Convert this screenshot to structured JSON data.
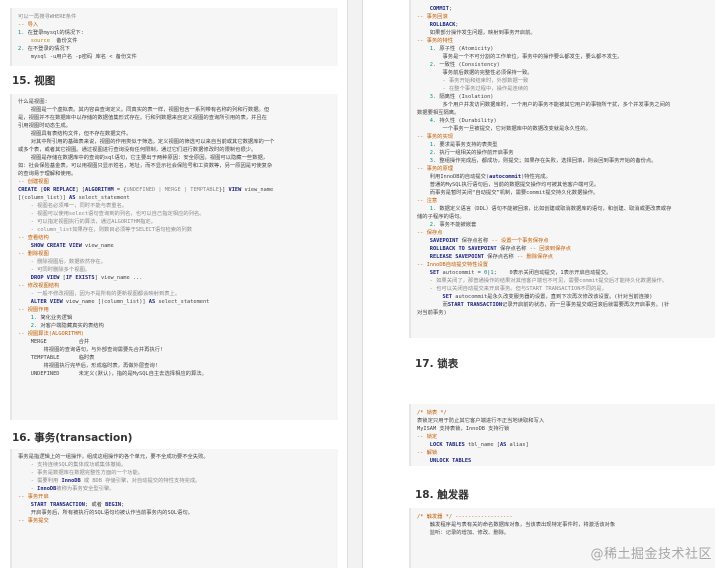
{
  "left": {
    "block1": [
      [
        [
          "c-gr",
          "可以一再搜寻WHERE条件"
        ]
      ],
      [
        [
          "c-cm",
          "-- 导入"
        ]
      ],
      [
        [
          "c-nm",
          "1."
        ],
        [
          "",
          " 在登录mysql的情况下:"
        ]
      ],
      [
        [
          "",
          "    "
        ],
        [
          "c-st",
          "source"
        ],
        [
          "",
          "  备份文件"
        ]
      ],
      [
        [
          "c-nm",
          "2."
        ],
        [
          "",
          " 在不登录的情况下"
        ]
      ],
      [
        [
          "",
          "    mysql -u用户名 -p密码 库名 < 备份文件"
        ]
      ]
    ],
    "h_views": "15. 视图",
    "block2": [
      [
        [
          "",
          "什么是视图:"
        ]
      ],
      [
        [
          "",
          "    视图是一个虚拟表。其内容由查询定义。同真实的表一样，视图包含一系列带有名称的列和行数据。但"
        ]
      ],
      [
        [
          "",
          "是，视图并不在数据库中以存储的数据值集形式存在。行和列数据来自定义视图的查询所引用的表，并且在"
        ]
      ],
      [
        [
          "",
          "引用视图时动态生成。"
        ]
      ],
      [
        [
          "",
          "    视图具有表结构文件，但不存在数据文件。"
        ]
      ],
      [
        [
          "",
          "    对其中所引用的基础表来说，视图的作用类似于筛选。定义视图的筛选可以来自当前或其它数据库的一个"
        ]
      ],
      [
        [
          "",
          "或多个表，或者其它视图。通过视图进行查询没有任何限制，通过它们进行数据修改时的限制也很少。"
        ]
      ],
      [
        [
          "",
          "    视图是存储在数据库中的查询的sql语句，它主要出于两种原因：安全原因，视图可以隐藏一些数据，"
        ]
      ],
      [
        [
          "",
          "如：社会保险基金表，可以用视图只显示姓名，地址，而不显示社会保险号和工资数等，另一原因是可使复杂"
        ]
      ],
      [
        [
          "",
          "的查询易于理解和使用。"
        ]
      ],
      [
        [
          "c-cm",
          "-- 创建视图"
        ]
      ],
      [
        [
          "c-kw",
          "CREATE"
        ],
        [
          "",
          " ["
        ],
        [
          "c-kw",
          "OR REPLACE"
        ],
        [
          "",
          "] ["
        ],
        [
          "c-kw",
          "ALGORITHM"
        ],
        [
          "",
          " = {"
        ],
        [
          "c-gr",
          "UNDEFINED | MERGE | TEMPTABLE"
        ],
        [
          "",
          "}] "
        ],
        [
          "c-kw",
          "VIEW"
        ],
        [
          "",
          " view_name"
        ]
      ],
      [
        [
          "",
          "[(column_list)] "
        ],
        [
          "c-kw",
          "AS"
        ],
        [
          "",
          " select_statement"
        ]
      ],
      [
        [
          "c-gr",
          "    - 视图名必须唯一，同时不能与表重名。"
        ]
      ],
      [
        [
          "c-gr",
          "    - 视图可以使用select语句查询到的列名，也可以自己指定相应的列名。"
        ]
      ],
      [
        [
          "c-gr",
          "    - 可以指定视图执行的算法，通过ALGORITHM指定。"
        ]
      ],
      [
        [
          "c-gr",
          "    - column_list如果存在，则数目必须等于SELECT语句检索的列数"
        ]
      ],
      [
        [
          "c-cm",
          "-- 查看结构"
        ]
      ],
      [
        [
          "",
          "    "
        ],
        [
          "c-kw",
          "SHOW CREATE VIEW"
        ],
        [
          "",
          " view_name"
        ]
      ],
      [
        [
          "c-cm",
          "-- 删除视图"
        ]
      ],
      [
        [
          "c-gr",
          "    - 删除视图后，数据依然存在。"
        ]
      ],
      [
        [
          "c-gr",
          "    - 可同时删除多个视图。"
        ]
      ],
      [
        [
          "",
          "    "
        ],
        [
          "c-kw",
          "DROP VIEW"
        ],
        [
          "",
          " ["
        ],
        [
          "c-kw",
          "IF EXISTS"
        ],
        [
          "",
          "] view_name ..."
        ]
      ],
      [
        [
          "c-cm",
          "-- 修改视图结构"
        ]
      ],
      [
        [
          "c-gr",
          "    - 一般不修改视图，因为不是所有的更新视图都会映射到表上。"
        ]
      ],
      [
        [
          "",
          "    "
        ],
        [
          "c-kw",
          "ALTER VIEW"
        ],
        [
          "",
          " view_name [(column_list)] "
        ],
        [
          "c-kw",
          "AS"
        ],
        [
          "",
          " select_statement"
        ]
      ],
      [
        [
          "c-cm",
          "-- 视图作用"
        ]
      ],
      [
        [
          "c-nm",
          "    1."
        ],
        [
          "",
          " 简化业务逻辑"
        ]
      ],
      [
        [
          "c-nm",
          "    2."
        ],
        [
          "",
          " 对客户端隐藏真实的表结构"
        ]
      ],
      [
        [
          "c-cm",
          "-- 视图算法(ALGORITHM)"
        ]
      ],
      [
        [
          "",
          "    MERGE          合并"
        ]
      ],
      [
        [
          "",
          "        将视图的查询语句，与外部查询需要先合并再执行!"
        ]
      ],
      [
        [
          "",
          "    TEMPTABLE      临时表"
        ]
      ],
      [
        [
          "",
          "        将视图执行完毕后，形成临时表，再做外层查询!"
        ]
      ],
      [
        [
          "",
          "    UNDEFINED      未定义(默认)，指的是MySQL自主去选择相应的算法。"
        ]
      ]
    ],
    "h_transaction": "16. 事务(transaction)",
    "block3": [
      [
        [
          "",
          "事务是指逻辑上的一组操作，组成这组操作的各个单元，要不全成功要不全失败。"
        ]
      ],
      [
        [
          "c-gr",
          "    - 支持连续SQL的集体成功或集体撤销。"
        ]
      ],
      [
        [
          "c-gr",
          "    - 事务是数据库在数据完整性方面的一个功能。"
        ]
      ],
      [
        [
          "c-gr",
          "    - 需要利用 "
        ],
        [
          "c-kw",
          "InnoDB"
        ],
        [
          "c-gr",
          " 或 BDB 存储引擎，对自动提交的特性支持完成。"
        ]
      ],
      [
        [
          "c-gr",
          "    - "
        ],
        [
          "c-kw",
          "InnoDB"
        ],
        [
          "c-gr",
          "被称为事务安全型引擎。"
        ]
      ],
      [
        [
          "c-cm",
          "-- 事务开启"
        ]
      ],
      [
        [
          "",
          "    "
        ],
        [
          "c-kw",
          "START TRANSACTION"
        ],
        [
          "",
          "; 或者 "
        ],
        [
          "c-kw",
          "BEGIN"
        ],
        [
          "",
          ";"
        ]
      ],
      [
        [
          "",
          "    开启事务后，所有被执行的SQL语句均被认作当前事务内的SQL语句。"
        ]
      ],
      [
        [
          "c-cm",
          "-- 事务提交"
        ]
      ]
    ]
  },
  "right": {
    "block1": [
      [
        [
          "",
          "    "
        ],
        [
          "c-kw",
          "COMMIT"
        ],
        [
          "",
          ";"
        ]
      ],
      [
        [
          "c-cm",
          "-- 事务回滚"
        ]
      ],
      [
        [
          "",
          "    "
        ],
        [
          "c-kw",
          "ROLLBACK"
        ],
        [
          "",
          ";"
        ]
      ],
      [
        [
          "",
          "    如果部分操作发生问题，映射到事务开启前。"
        ]
      ],
      [
        [
          "c-cm",
          "-- 事务的特性"
        ]
      ],
      [
        [
          "c-nm",
          "    1."
        ],
        [
          "",
          " 原子性 (Atomicity)"
        ]
      ],
      [
        [
          "",
          "        事务是一个不可分割的工作单位，事务中的操作要么都发生，要么都不发生。"
        ]
      ],
      [
        [
          "c-nm",
          "    2."
        ],
        [
          "",
          " 一致性 (Consistency)"
        ]
      ],
      [
        [
          "",
          "        事务前后数据的完整性必须保持一致。"
        ]
      ],
      [
        [
          "c-gr",
          "        - 事务开始和结束时，外部数据一致"
        ]
      ],
      [
        [
          "c-gr",
          "        - 在整个事务过程中，操作是连续的"
        ]
      ],
      [
        [
          "c-nm",
          "    3."
        ],
        [
          "",
          " 隔离性 (Isolation)"
        ]
      ],
      [
        [
          "",
          "        多个用户并发访问数据库时，一个用户的事务不能被其它用户的事物所干扰，多个并发事务之间的"
        ]
      ],
      [
        [
          "",
          "数据要相互隔离。"
        ]
      ],
      [
        [
          "c-nm",
          "    4."
        ],
        [
          "",
          " 持久性 (Durability)"
        ]
      ],
      [
        [
          "",
          "        一个事务一旦被提交，它对数据库中的数据改变就是永久性的。"
        ]
      ],
      [
        [
          "c-cm",
          "-- 事务的实现"
        ]
      ],
      [
        [
          "c-nm",
          "    1."
        ],
        [
          "",
          " 要求是事务支持的表类型"
        ]
      ],
      [
        [
          "c-nm",
          "    2."
        ],
        [
          "",
          " 执行一组相关的操作前开启事务"
        ]
      ],
      [
        [
          "c-nm",
          "    3."
        ],
        [
          "",
          " 整组操作完成后，都成功，则提交；如果存在失败，选择回滚，则会回到事务开始的备份点。"
        ]
      ],
      [
        [
          "c-cm",
          "-- 事务的原理"
        ]
      ],
      [
        [
          "",
          "    利用InnoDB的自动提交("
        ],
        [
          "c-kw",
          "autocommit"
        ],
        [
          "",
          ")特性完成。"
        ]
      ],
      [
        [
          "",
          "    普通的MySQL执行语句后，当前的数据提交操作均可被其他客户端可见。"
        ]
      ],
      [
        [
          "",
          "    而事务是暂时关闭“自动提交”机制，需要commit提交持久化数据操作。"
        ]
      ],
      [
        [
          "c-cm",
          "-- 注意"
        ]
      ],
      [
        [
          "c-nm",
          "    1."
        ],
        [
          "",
          " 数据定义语言（DDL）语句不能被回滚，比如创建或取消数据库的语句，和创建、取消或更改表或存"
        ]
      ],
      [
        [
          "",
          "储的子程序的语句。"
        ]
      ],
      [
        [
          "c-nm",
          "    2."
        ],
        [
          "",
          " 事务不能被嵌套"
        ]
      ],
      [
        [
          "c-cm",
          "-- 保存点"
        ]
      ],
      [
        [
          "",
          "    "
        ],
        [
          "c-kw",
          "SAVEPOINT"
        ],
        [
          "",
          " 保存点名称 "
        ],
        [
          "c-cm",
          "-- 设置一个事务保存点"
        ]
      ],
      [
        [
          "",
          "    "
        ],
        [
          "c-kw",
          "ROLLBACK TO SAVEPOINT"
        ],
        [
          "",
          " 保存点名称 "
        ],
        [
          "c-cm",
          "-- 回滚到保存点"
        ]
      ],
      [
        [
          "",
          "    "
        ],
        [
          "c-kw",
          "RELEASE SAVEPOINT"
        ],
        [
          "",
          " 保存点名称 "
        ],
        [
          "c-cm",
          "-- 删除保存点"
        ]
      ],
      [
        [
          "c-cm",
          "-- InnoDB自动提交特性设置"
        ]
      ],
      [
        [
          "",
          "    "
        ],
        [
          "c-kw",
          "SET"
        ],
        [
          "",
          " autocommit = "
        ],
        [
          "c-nm",
          "0"
        ],
        [
          "",
          "|"
        ],
        [
          "c-nm",
          "1"
        ],
        [
          "",
          ";    0表示关闭自动提交，1表示开启自动提交。"
        ]
      ],
      [
        [
          "c-gr",
          "    - 如果关闭了，那普通操作的结果对其他客户端也不可见，需要commit提交后才能持久化数据操作。"
        ]
      ],
      [
        [
          "c-gr",
          "    - 也可以关闭自动提交来开启事务。但与START TRANSACTION不同的是，"
        ]
      ],
      [
        [
          "",
          "        "
        ],
        [
          "c-kw",
          "SET"
        ],
        [
          "",
          " autocommit是永久改变服务器的设置，直到下次再次修改该设置。(针对当前连接)"
        ]
      ],
      [
        [
          "",
          "        而"
        ],
        [
          "c-kw",
          "START TRANSACTION"
        ],
        [
          "",
          "记录开启前的状态，而一旦事务提交或回滚后就需要再次开启事务。(针"
        ]
      ],
      [
        [
          "",
          "对当前事务)"
        ]
      ]
    ],
    "h_locks": "17. 锁表",
    "block2": [
      [
        [
          "c-cm",
          "/* 锁表 */"
        ]
      ],
      [
        [
          "",
          "表锁定只用于防止其它客户端进行不正当地读取和写入"
        ]
      ],
      [
        [
          "",
          "MyISAM 支持表锁，InnoDB 支持行锁"
        ]
      ],
      [
        [
          "c-cm",
          "-- 锁定"
        ]
      ],
      [
        [
          "",
          "    "
        ],
        [
          "c-kw",
          "LOCK TABLES"
        ],
        [
          "",
          " tbl_name ["
        ],
        [
          "c-kw",
          "AS"
        ],
        [
          "",
          " alias]"
        ]
      ],
      [
        [
          "c-cm",
          "-- 解锁"
        ]
      ],
      [
        [
          "",
          "    "
        ],
        [
          "c-kw",
          "UNLOCK TABLES"
        ]
      ]
    ],
    "h_triggers": "18. 触发器",
    "block3": [
      [
        [
          "c-cm",
          "/* 触发器 */ ------------------"
        ]
      ],
      [
        [
          "",
          "    触发程序是与表有关的命名数据库对象，当该表出现特定事件时，将激活该对象"
        ]
      ],
      [
        [
          "",
          "    监听：记录的增加、修改、删除。"
        ]
      ]
    ]
  },
  "watermark": "@稀土掘金技术社区"
}
